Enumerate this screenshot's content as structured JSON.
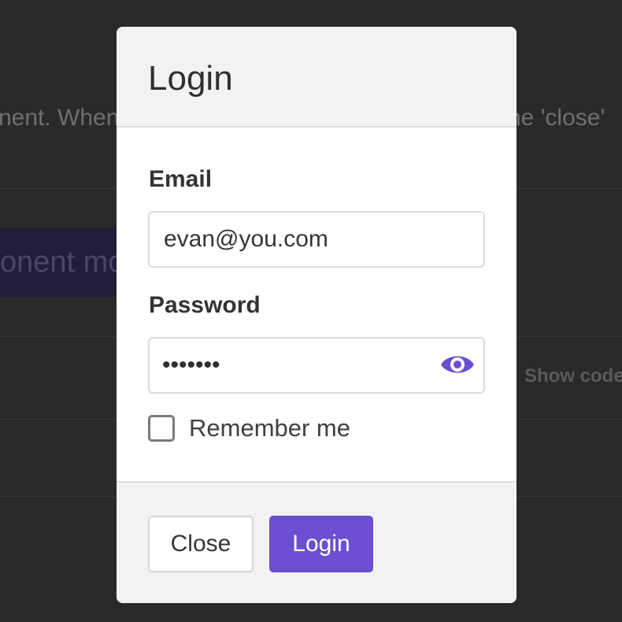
{
  "background": {
    "text_left": "nent. When",
    "text_right": "he 'close'",
    "button_label": "onent mo",
    "show_code": "Show code"
  },
  "modal": {
    "title": "Login",
    "email": {
      "label": "Email",
      "value": "evan@you.com"
    },
    "password": {
      "label": "Password",
      "masked_value": "•••••••",
      "reveal_icon": "eye-icon"
    },
    "remember": {
      "label": "Remember me",
      "checked": false
    },
    "footer": {
      "close_label": "Close",
      "login_label": "Login"
    }
  },
  "colors": {
    "accent": "#6b4fd0",
    "overlay": "#2a2a2a",
    "header_bg": "#f2f2f2"
  }
}
